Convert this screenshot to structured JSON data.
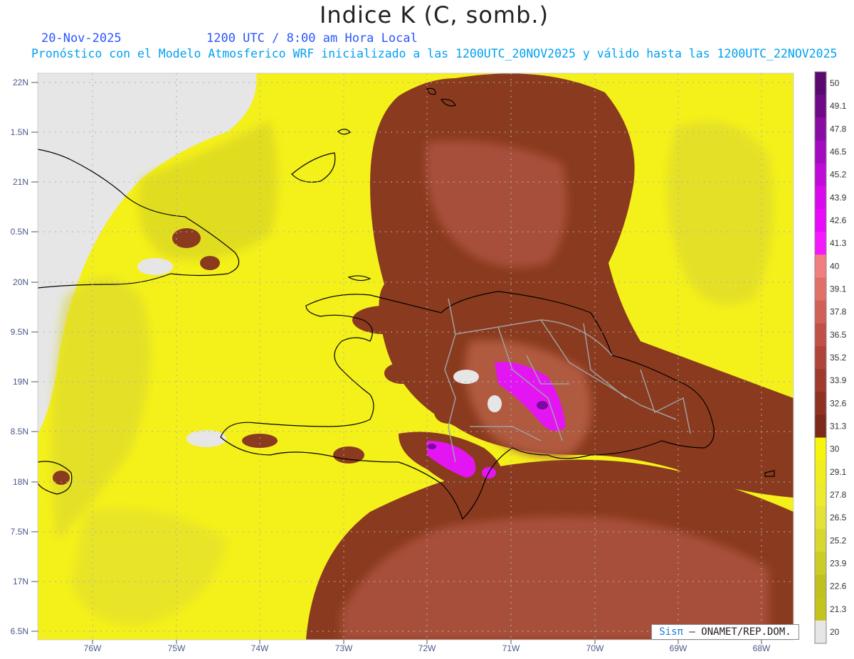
{
  "header": {
    "title": "Indice K (C, somb.)",
    "date": "20-Nov-2025",
    "time": "1200 UTC / 8:00 am Hora Local",
    "description": "Pronóstico con el Modelo Atmosferico WRF inicializado a las 1200UTC_20NOV2025 y válido hasta las  1200UTC_22NOV2025"
  },
  "axes": {
    "lat_labels": [
      "22N",
      "1.5N",
      "21N",
      "0.5N",
      "20N",
      "9.5N",
      "19N",
      "8.5N",
      "18N",
      "7.5N",
      "17N",
      "6.5N"
    ],
    "lon_labels": [
      "76W",
      "75W",
      "74W",
      "73W",
      "72W",
      "71W",
      "70W",
      "69W",
      "68W"
    ]
  },
  "colorbar": {
    "labels": [
      "50",
      "49.1",
      "47.8",
      "46.5",
      "45.2",
      "43.9",
      "42.6",
      "41.3",
      "40",
      "39.1",
      "37.8",
      "36.5",
      "35.2",
      "33.9",
      "32.6",
      "31.3",
      "30",
      "29.1",
      "27.8",
      "26.5",
      "25.2",
      "23.9",
      "22.6",
      "21.3",
      "20"
    ],
    "colors": [
      "#5a0a6e",
      "#6e0a86",
      "#8a0aa4",
      "#a40ac0",
      "#c00ad8",
      "#d80aec",
      "#e80af8",
      "#f41aff",
      "#f08080",
      "#e07068",
      "#d06058",
      "#c05048",
      "#b04438",
      "#a03a2c",
      "#903222",
      "#7e2a1a",
      "#f7f50e",
      "#f0ee20",
      "#eceb30",
      "#e4e238",
      "#d8d630",
      "#cccc28",
      "#c0c020",
      "#c4c41c",
      "#e6e6e6"
    ]
  },
  "credit": {
    "sis": "Sisπ",
    "org": "– ONAMET/REP.DOM."
  },
  "colors": {
    "background": "#ffffff",
    "no_data": "#e6e6e6",
    "low_k": "#f2f01a",
    "mid_k": "#8b3a1e",
    "high_k": "#e016f0",
    "coastline": "#000000",
    "borders": "#a0a0a0"
  }
}
